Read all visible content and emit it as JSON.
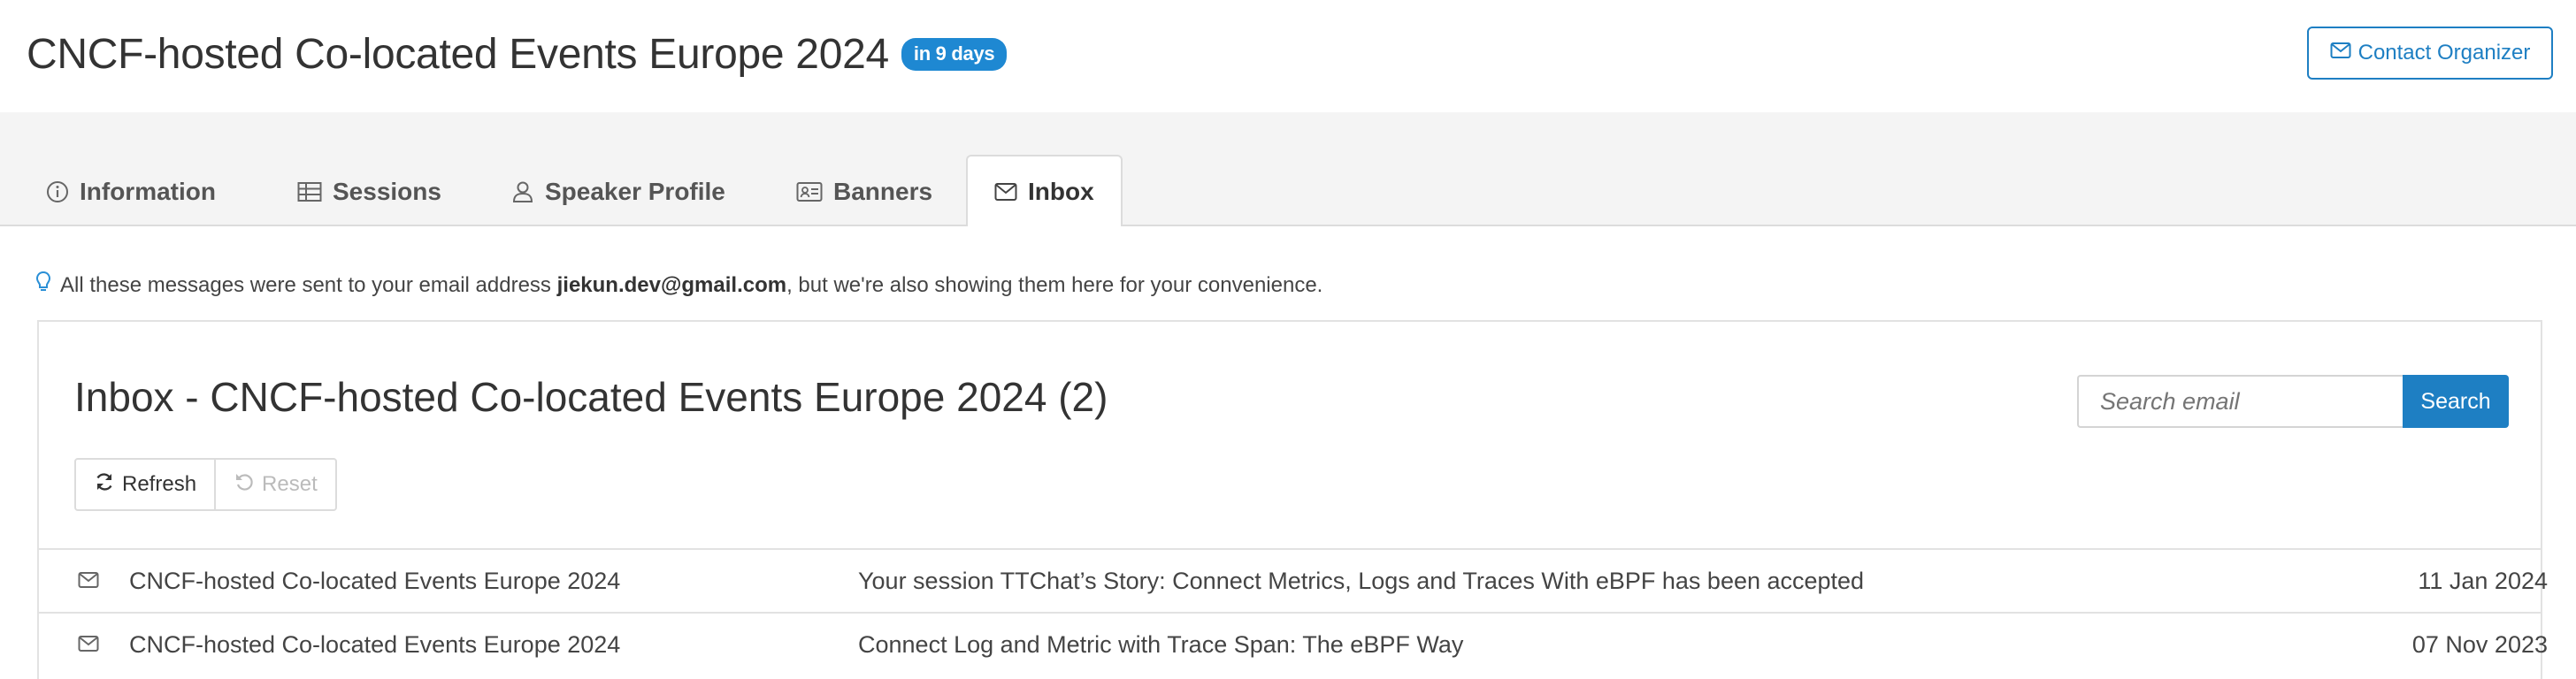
{
  "header": {
    "event_title": "CNCF-hosted Co-located Events Europe 2024",
    "countdown_badge": "in 9 days",
    "contact_button": "Contact Organizer"
  },
  "tabs": [
    {
      "label": "Information",
      "icon": "info-circle-icon",
      "active": false
    },
    {
      "label": "Sessions",
      "icon": "table-icon",
      "active": false
    },
    {
      "label": "Speaker Profile",
      "icon": "user-icon",
      "active": false
    },
    {
      "label": "Banners",
      "icon": "id-card-icon",
      "active": false
    },
    {
      "label": "Inbox",
      "icon": "envelope-icon",
      "active": true
    }
  ],
  "notice": {
    "prefix": "All these messages were sent to your email address ",
    "email": "jiekun.dev@gmail.com",
    "suffix": ", but we're also showing them here for your convenience."
  },
  "inbox": {
    "title": "Inbox - CNCF-hosted Co-located Events Europe 2024 (2)",
    "search_placeholder": "Search email",
    "search_button": "Search",
    "refresh_button": "Refresh",
    "reset_button": "Reset",
    "messages": [
      {
        "sender": "CNCF-hosted Co-located Events Europe 2024",
        "subject": "Your session TTChat’s Story: Connect Metrics, Logs and Traces With eBPF has been accepted",
        "date": "11 Jan 2024"
      },
      {
        "sender": "CNCF-hosted Co-located Events Europe 2024",
        "subject": "Connect Log and Metric with Trace Span: The eBPF Way",
        "date": "07 Nov 2023"
      }
    ]
  },
  "colors": {
    "accent": "#1e7fc3",
    "badge": "#1e88d2",
    "tabbar_bg": "#f4f4f4"
  }
}
